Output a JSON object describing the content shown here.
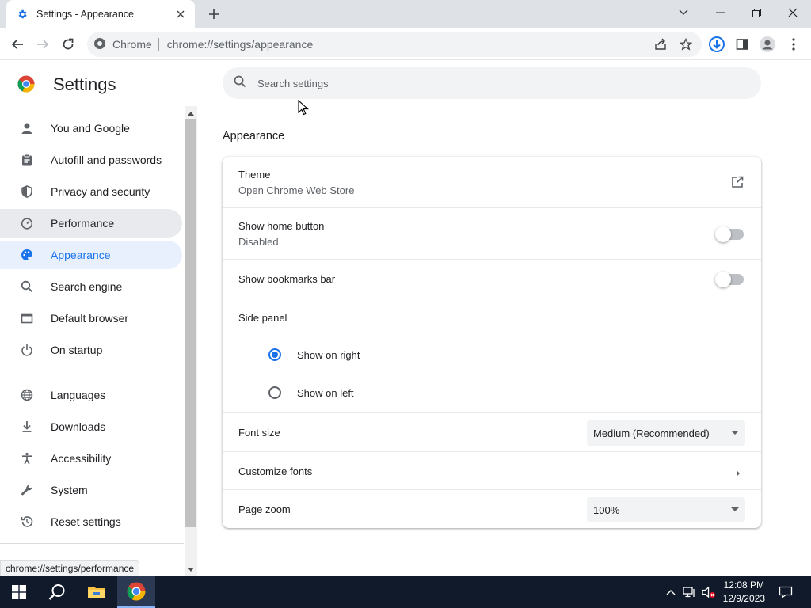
{
  "tab": {
    "title": "Settings - Appearance"
  },
  "omnibox": {
    "site": "Chrome",
    "url": "chrome://settings/appearance"
  },
  "header": {
    "title": "Settings"
  },
  "search": {
    "placeholder": "Search settings"
  },
  "sidebar": {
    "items": [
      {
        "label": "You and Google",
        "icon": "person-icon"
      },
      {
        "label": "Autofill and passwords",
        "icon": "clipboard-icon"
      },
      {
        "label": "Privacy and security",
        "icon": "shield-icon"
      },
      {
        "label": "Performance",
        "icon": "speedometer-icon",
        "state": "hover"
      },
      {
        "label": "Appearance",
        "icon": "palette-icon",
        "state": "selected"
      },
      {
        "label": "Search engine",
        "icon": "search-icon"
      },
      {
        "label": "Default browser",
        "icon": "browser-icon"
      },
      {
        "label": "On startup",
        "icon": "power-icon"
      },
      {
        "label": "Languages",
        "icon": "globe-icon"
      },
      {
        "label": "Downloads",
        "icon": "download-icon"
      },
      {
        "label": "Accessibility",
        "icon": "accessibility-icon"
      },
      {
        "label": "System",
        "icon": "wrench-icon"
      },
      {
        "label": "Reset settings",
        "icon": "history-icon"
      }
    ]
  },
  "appearance": {
    "section_title": "Appearance",
    "theme": {
      "label": "Theme",
      "sub": "Open Chrome Web Store"
    },
    "home_button": {
      "label": "Show home button",
      "sub": "Disabled",
      "enabled": false
    },
    "bookmarks_bar": {
      "label": "Show bookmarks bar",
      "enabled": false
    },
    "side_panel": {
      "label": "Side panel",
      "options": [
        "Show on right",
        "Show on left"
      ],
      "selected": "Show on right"
    },
    "font_size": {
      "label": "Font size",
      "value": "Medium (Recommended)"
    },
    "customize_fonts": {
      "label": "Customize fonts"
    },
    "page_zoom": {
      "label": "Page zoom",
      "value": "100%"
    }
  },
  "status_bar": {
    "url": "chrome://settings/performance"
  },
  "taskbar": {
    "time": "12:08 PM",
    "date": "12/9/2023"
  },
  "colors": {
    "accent": "#1a73e8",
    "selected_bg": "#e8f0fe",
    "taskbar": "#101a2b"
  }
}
